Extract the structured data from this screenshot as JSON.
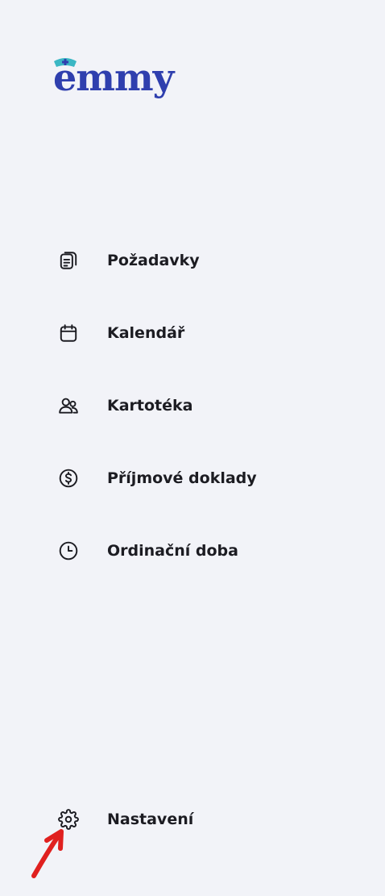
{
  "brand": {
    "name": "emmy",
    "color": "#2f3fae",
    "cap_color": "#3bb7c4"
  },
  "nav": {
    "items": [
      {
        "label": "Požadavky",
        "icon": "document-stack-icon"
      },
      {
        "label": "Kalendář",
        "icon": "calendar-icon"
      },
      {
        "label": "Kartotéka",
        "icon": "patients-icon"
      },
      {
        "label": "Příjmové doklady",
        "icon": "dollar-circle-icon"
      },
      {
        "label": "Ordinační doba",
        "icon": "clock-icon"
      }
    ],
    "settings": {
      "label": "Nastavení",
      "icon": "gear-icon"
    }
  },
  "annotation": {
    "color": "#e0201f",
    "icon": "red-arrow-icon"
  }
}
